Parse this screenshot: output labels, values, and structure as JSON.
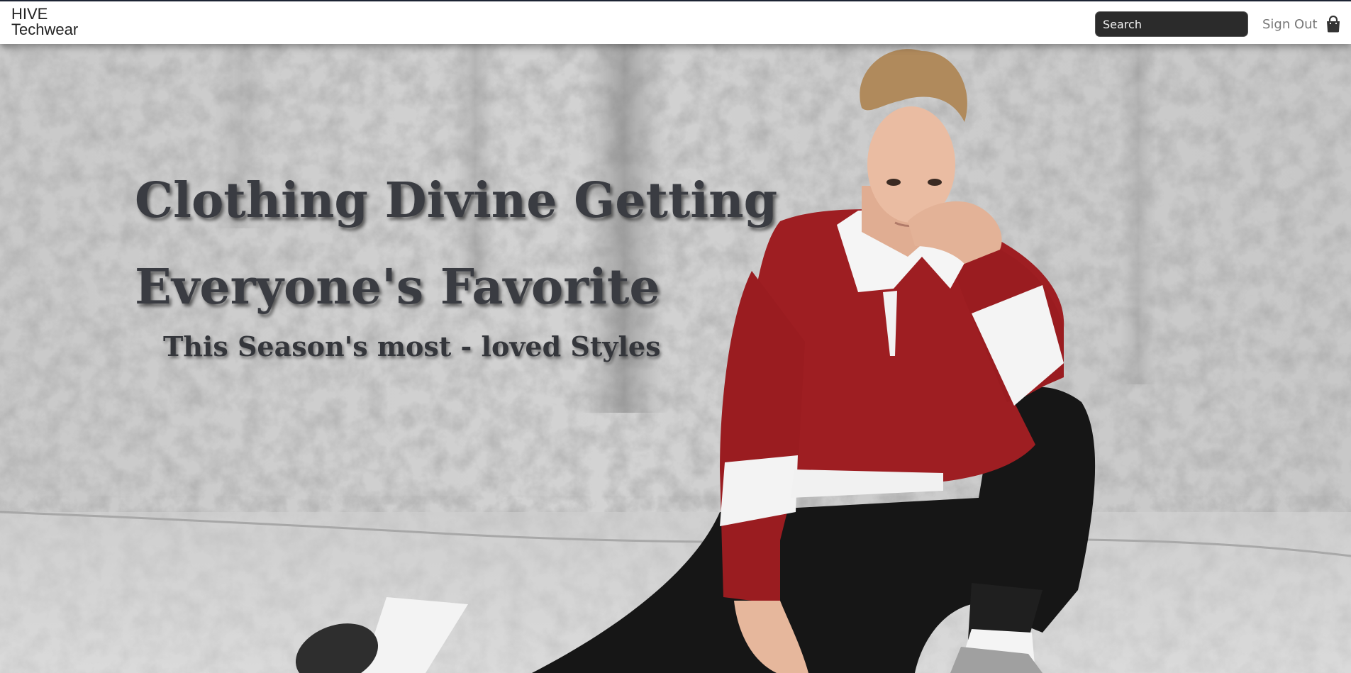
{
  "navbar": {
    "brand_line1": "HIVE",
    "brand_line2": "Techwear",
    "search_placeholder": "Search",
    "signout_label": "Sign Out",
    "cart_icon": "shopping-bag-icon"
  },
  "hero": {
    "headline_line1": "Clothing Divine Getting",
    "headline_line2": "Everyone's Favorite",
    "subheadline": "This Season's most - loved Styles",
    "background_image": "model-sitting-against-concrete-wall"
  },
  "colors": {
    "navbar_border": "#1c2333",
    "search_bg": "#2b2b2b",
    "headline_text": "#3a3c42",
    "shirt_red": "#9e1e22"
  }
}
